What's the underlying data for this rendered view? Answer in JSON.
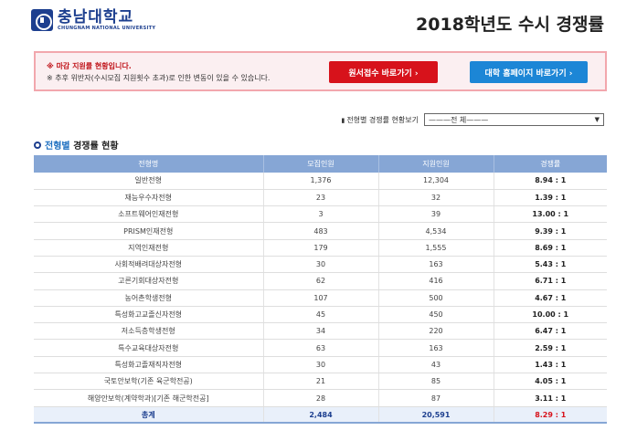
{
  "header": {
    "logo_ko": "충남대학교",
    "logo_en": "CHUNGNAM NATIONAL UNIVERSITY",
    "title": "2018학년도 수시 경쟁률"
  },
  "notice": {
    "line1": "※ 마감 지원률 현황입니다.",
    "line2": "※ 추후 위반자(수시모집 지원횟수 초과)로 인한 변동이 있을 수 있습니다.",
    "apply_button": "원서접수 바로가기 ›",
    "homepage_button": "대학 홈페이지 바로가기 ›"
  },
  "filter": {
    "label": "전형별 경쟁률 현황보기",
    "selected": "———전 체———"
  },
  "section": {
    "title_accent": "전형별",
    "title_rest": " 경쟁률 현황"
  },
  "table": {
    "headers": [
      "전형명",
      "모집인원",
      "지원인원",
      "경쟁률"
    ],
    "rows": [
      [
        "일반전형",
        "1,376",
        "12,304",
        "8.94 : 1"
      ],
      [
        "재능우수자전형",
        "23",
        "32",
        "1.39 : 1"
      ],
      [
        "소프트웨어인재전형",
        "3",
        "39",
        "13.00 : 1"
      ],
      [
        "PRISM인재전형",
        "483",
        "4,534",
        "9.39 : 1"
      ],
      [
        "지역인재전형",
        "179",
        "1,555",
        "8.69 : 1"
      ],
      [
        "사회적배려대상자전형",
        "30",
        "163",
        "5.43 : 1"
      ],
      [
        "고른기회대상자전형",
        "62",
        "416",
        "6.71 : 1"
      ],
      [
        "농어촌학생전형",
        "107",
        "500",
        "4.67 : 1"
      ],
      [
        "특성화고교졸신자전형",
        "45",
        "450",
        "10.00 : 1"
      ],
      [
        "저소득층학생전형",
        "34",
        "220",
        "6.47 : 1"
      ],
      [
        "특수교육대상자전형",
        "63",
        "163",
        "2.59 : 1"
      ],
      [
        "특성화고졸재직자전형",
        "30",
        "43",
        "1.43 : 1"
      ],
      [
        "국토안보학(기존 육군학전공)",
        "21",
        "85",
        "4.05 : 1"
      ],
      [
        "해양안보학(계약학과)[기존 해군학전공]",
        "28",
        "87",
        "3.11 : 1"
      ]
    ],
    "total": [
      "총계",
      "2,484",
      "20,591",
      "8.29 : 1"
    ]
  }
}
